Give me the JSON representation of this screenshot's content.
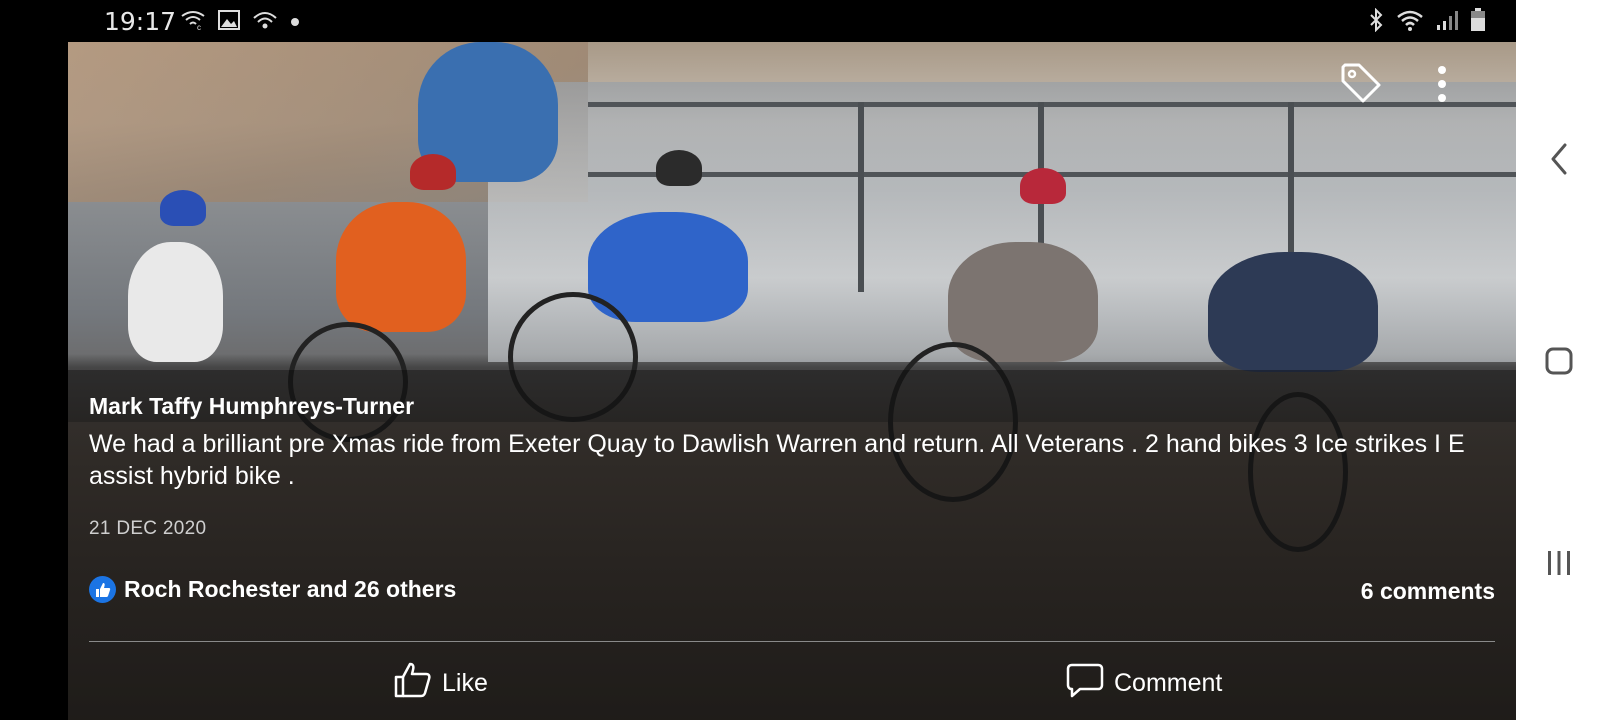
{
  "status_bar": {
    "time": "19:17",
    "left_icons": [
      "wifi-calling-icon",
      "gallery-icon",
      "hotspot-icon",
      "dot-icon"
    ],
    "right_icons": [
      "bluetooth-icon",
      "wifi-icon",
      "signal-icon",
      "battery-icon"
    ]
  },
  "top_actions": {
    "icons": [
      "tag-icon",
      "more-options-icon"
    ]
  },
  "post": {
    "author": "Mark Taffy Humphreys-Turner",
    "caption": "We had a brilliant pre Xmas ride from Exeter Quay to Dawlish Warren and return. All Veterans  . 2 hand bikes 3 Ice strikes I E assist hybrid bike .",
    "date": "21 DEC 2020",
    "likes_text": "Roch Rochester and 26 others",
    "comments_text": "6 comments"
  },
  "actions": {
    "like_label": "Like",
    "comment_label": "Comment"
  },
  "nav_bar": {
    "icons": [
      "back-icon",
      "home-icon",
      "recent-apps-icon"
    ]
  },
  "colors": {
    "like_badge": "#1b74e4",
    "background": "#000000",
    "nav_bar": "#ffffff"
  }
}
